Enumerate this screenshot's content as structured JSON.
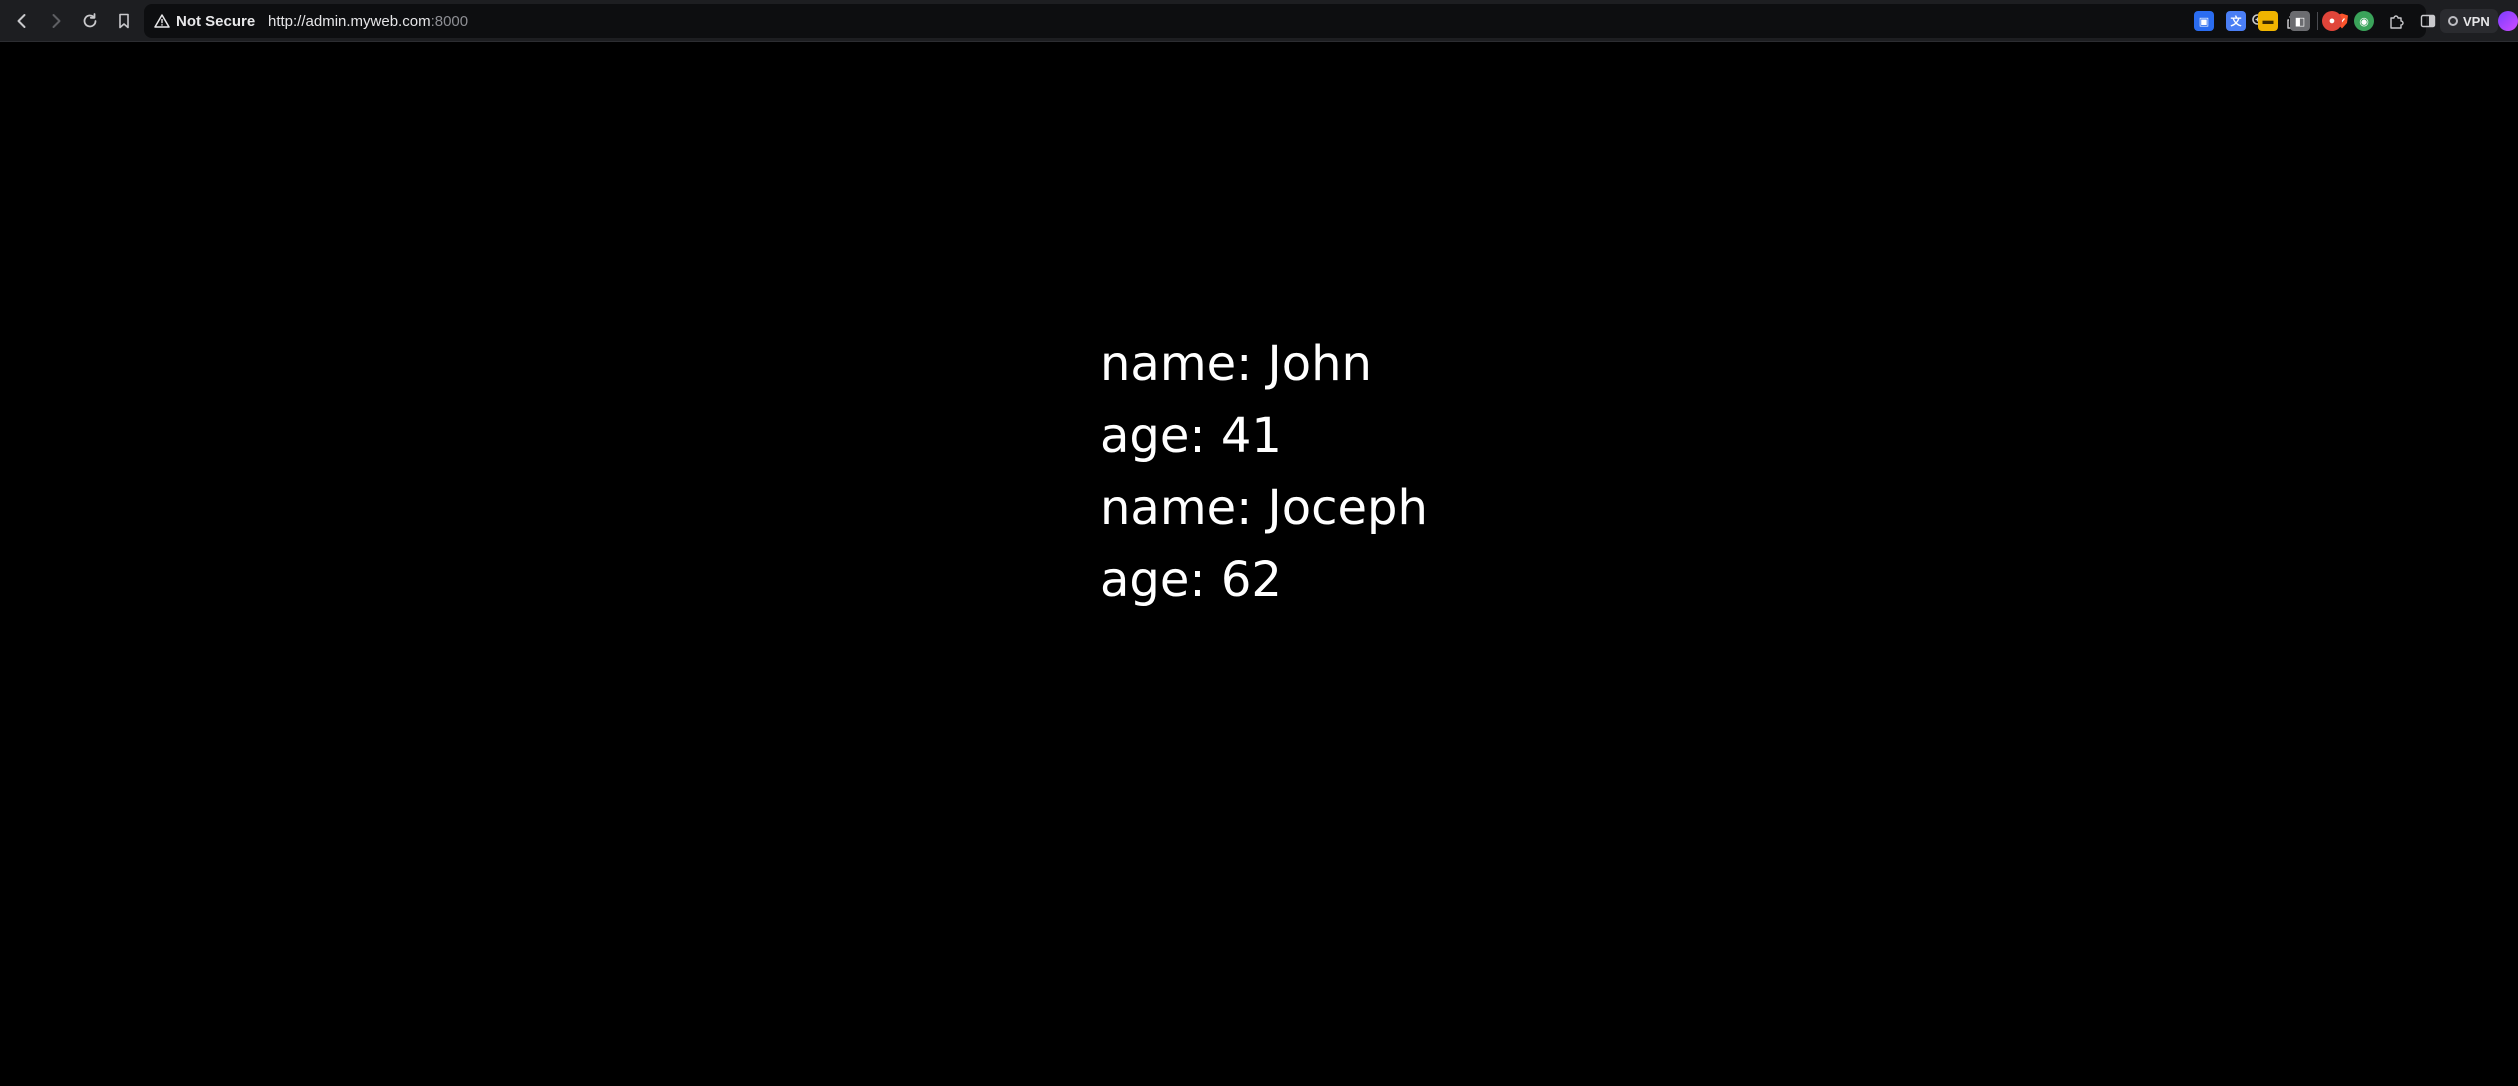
{
  "browser": {
    "security_label": "Not Secure",
    "url_host": "http://admin.myweb.com",
    "url_port": ":8000",
    "vpn_label": "VPN",
    "nav_icons": [
      "back-icon",
      "forward-icon",
      "reload-icon",
      "bookmark-icon"
    ],
    "extensions": [
      {
        "icon": "brave-shield-icon",
        "color": "#fb542b"
      },
      {
        "icon": "extension-blue-icon",
        "color": "#2a6cf0"
      },
      {
        "icon": "translate-icon",
        "color": "#4a7ef5"
      },
      {
        "icon": "extension-yellow-icon",
        "color": "#f0b400"
      },
      {
        "icon": "extension-gray-icon",
        "color": "#6b6c70"
      },
      {
        "icon": "extension-red-icon",
        "color": "#e0453a"
      },
      {
        "icon": "extension-green-icon",
        "color": "#3aa35a"
      },
      {
        "icon": "extensions-puzzle-icon",
        "color": "#1d1e21"
      },
      {
        "icon": "sidebar-icon",
        "color": "#1d1e21"
      }
    ]
  },
  "page": {
    "records": [
      {
        "name_label": "name: John",
        "age_label": "age: 41"
      },
      {
        "name_label": "name: Joceph",
        "age_label": "age: 62"
      }
    ]
  }
}
